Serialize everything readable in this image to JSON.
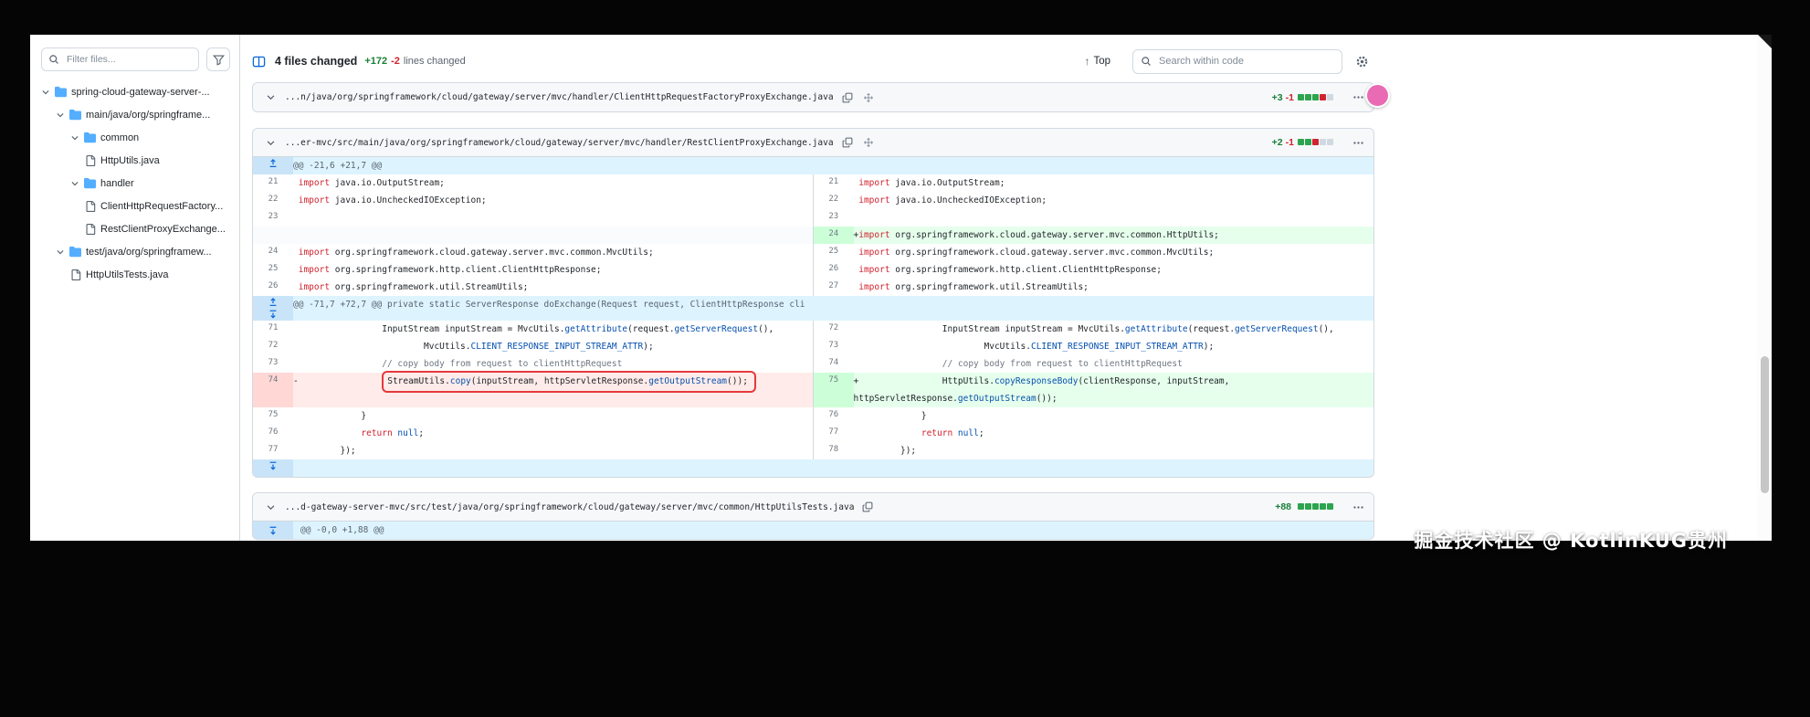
{
  "toolbar": {
    "files_changed": "4 files changed",
    "additions": "+172",
    "deletions": "-2",
    "lines_changed_label": "lines changed",
    "top_button": "Top",
    "search_placeholder": "Search within code"
  },
  "sidebar": {
    "filter_placeholder": "Filter files...",
    "tree": [
      {
        "label": "spring-cloud-gateway-server-...",
        "type": "folder",
        "indent": 0
      },
      {
        "label": "main/java/org/springframe...",
        "type": "folder",
        "indent": 1
      },
      {
        "label": "common",
        "type": "folder",
        "indent": 2
      },
      {
        "label": "HttpUtils.java",
        "type": "file",
        "indent": 3
      },
      {
        "label": "handler",
        "type": "folder",
        "indent": 2
      },
      {
        "label": "ClientHttpRequestFactory...",
        "type": "file",
        "indent": 3
      },
      {
        "label": "RestClientProxyExchange...",
        "type": "file",
        "indent": 3
      },
      {
        "label": "test/java/org/springframew...",
        "type": "folder",
        "indent": 1
      },
      {
        "label": "HttpUtilsTests.java",
        "type": "file",
        "indent": 2
      }
    ]
  },
  "files": [
    {
      "path": "...n/java/org/springframework/cloud/gateway/server/mvc/handler/ClientHttpRequestFactoryProxyExchange.java",
      "additions": "+3",
      "deletions": "-1",
      "blocks": [
        "add",
        "add",
        "add",
        "del",
        "neutral"
      ]
    },
    {
      "path": "...er-mvc/src/main/java/org/springframework/cloud/gateway/server/mvc/handler/RestClientProxyExchange.java",
      "additions": "+2",
      "deletions": "-1",
      "blocks": [
        "add",
        "add",
        "del",
        "neutral",
        "neutral"
      ]
    },
    {
      "path": "...d-gateway-server-mvc/src/test/java/org/springframework/cloud/gateway/server/mvc/common/HttpUtilsTests.java",
      "additions": "+88",
      "deletions": "",
      "blocks": [
        "add",
        "add",
        "add",
        "add",
        "add"
      ],
      "partial_hunk": "@@ -0,0 +1,88 @@"
    }
  ],
  "diff": {
    "rows": [
      {
        "type": "hunk",
        "expand": "up",
        "text": "@@ -21,6 +21,7 @@"
      },
      {
        "type": "ctx",
        "ln": "21",
        "rn": "21",
        "indent": "",
        "code": [
          {
            "t": "import",
            "c": "k"
          },
          {
            "t": " java.io.OutputStream;",
            "c": "p"
          }
        ]
      },
      {
        "type": "ctx",
        "ln": "22",
        "rn": "22",
        "indent": "",
        "code": [
          {
            "t": "import",
            "c": "k"
          },
          {
            "t": " java.io.UncheckedIOException;",
            "c": "p"
          }
        ]
      },
      {
        "type": "ctx",
        "ln": "23",
        "rn": "23",
        "indent": "",
        "code": []
      },
      {
        "type": "pair",
        "left": null,
        "right": {
          "n": "24",
          "kind": "add",
          "indent": "",
          "code": [
            {
              "t": "import",
              "c": "k"
            },
            {
              "t": " org.springframework.cloud.gateway.server.mvc.common.HttpUtils;",
              "c": "p"
            }
          ]
        }
      },
      {
        "type": "ctx",
        "ln": "24",
        "rn": "25",
        "indent": "",
        "code": [
          {
            "t": "import",
            "c": "k"
          },
          {
            "t": " org.springframework.cloud.gateway.server.mvc.common.MvcUtils;",
            "c": "p"
          }
        ]
      },
      {
        "type": "ctx",
        "ln": "25",
        "rn": "26",
        "indent": "",
        "code": [
          {
            "t": "import",
            "c": "k"
          },
          {
            "t": " org.springframework.http.client.ClientHttpResponse;",
            "c": "p"
          }
        ]
      },
      {
        "type": "ctx",
        "ln": "26",
        "rn": "27",
        "indent": "",
        "code": [
          {
            "t": "import",
            "c": "k"
          },
          {
            "t": " org.springframework.util.StreamUtils;",
            "c": "p"
          }
        ]
      },
      {
        "type": "hunk",
        "expand": "both",
        "text": "@@ -71,7 +72,7 @@ private static ServerResponse doExchange(Request request, ClientHttpResponse cli"
      },
      {
        "type": "ctx",
        "ln": "71",
        "rn": "72",
        "indent": "                ",
        "code": [
          {
            "t": "InputStream inputStream = MvcUtils.",
            "c": "p"
          },
          {
            "t": "getAttribute",
            "c": "f"
          },
          {
            "t": "(request.",
            "c": "p"
          },
          {
            "t": "getServerRequest",
            "c": "f"
          },
          {
            "t": "(),",
            "c": "p"
          }
        ]
      },
      {
        "type": "ctx",
        "ln": "72",
        "rn": "73",
        "indent": "                        ",
        "code": [
          {
            "t": "MvcUtils.",
            "c": "p"
          },
          {
            "t": "CLIENT_RESPONSE_INPUT_STREAM_ATTR",
            "c": "f"
          },
          {
            "t": ");",
            "c": "p"
          }
        ]
      },
      {
        "type": "ctx",
        "ln": "73",
        "rn": "74",
        "indent": "                ",
        "code": [
          {
            "t": "// copy body from request to clientHttpRequest",
            "c": "c"
          }
        ]
      },
      {
        "type": "pair",
        "left": {
          "n": "74",
          "kind": "del",
          "indent": "                ",
          "boxed": true,
          "code": [
            {
              "t": "StreamUtils.",
              "c": "p"
            },
            {
              "t": "copy",
              "c": "f"
            },
            {
              "t": "(inputStream, httpServletResponse.",
              "c": "p"
            },
            {
              "t": "getOutputStream",
              "c": "f"
            },
            {
              "t": "());",
              "c": "p"
            }
          ]
        },
        "right": {
          "n": "75",
          "kind": "add",
          "indent": "                ",
          "code": [
            {
              "t": "HttpUtils.",
              "c": "p"
            },
            {
              "t": "copyResponseBody",
              "c": "f"
            },
            {
              "t": "(clientResponse, inputStream, httpServletResponse.",
              "c": "p"
            },
            {
              "t": "getOutputStream",
              "c": "f"
            },
            {
              "t": "());",
              "c": "p"
            }
          ]
        }
      },
      {
        "type": "ctx",
        "ln": "75",
        "rn": "76",
        "indent": "            ",
        "code": [
          {
            "t": "}",
            "c": "p"
          }
        ]
      },
      {
        "type": "ctx",
        "ln": "76",
        "rn": "77",
        "indent": "            ",
        "code": [
          {
            "t": "return",
            "c": "k"
          },
          {
            "t": " ",
            "c": "p"
          },
          {
            "t": "null",
            "c": "f"
          },
          {
            "t": ";",
            "c": "p"
          }
        ]
      },
      {
        "type": "ctx",
        "ln": "77",
        "rn": "78",
        "indent": "        ",
        "code": [
          {
            "t": "});",
            "c": "p"
          }
        ]
      },
      {
        "type": "hunk",
        "expand": "down",
        "text": ""
      }
    ]
  },
  "watermark": "掘金技术社区 @ KotlinKUG贵州"
}
